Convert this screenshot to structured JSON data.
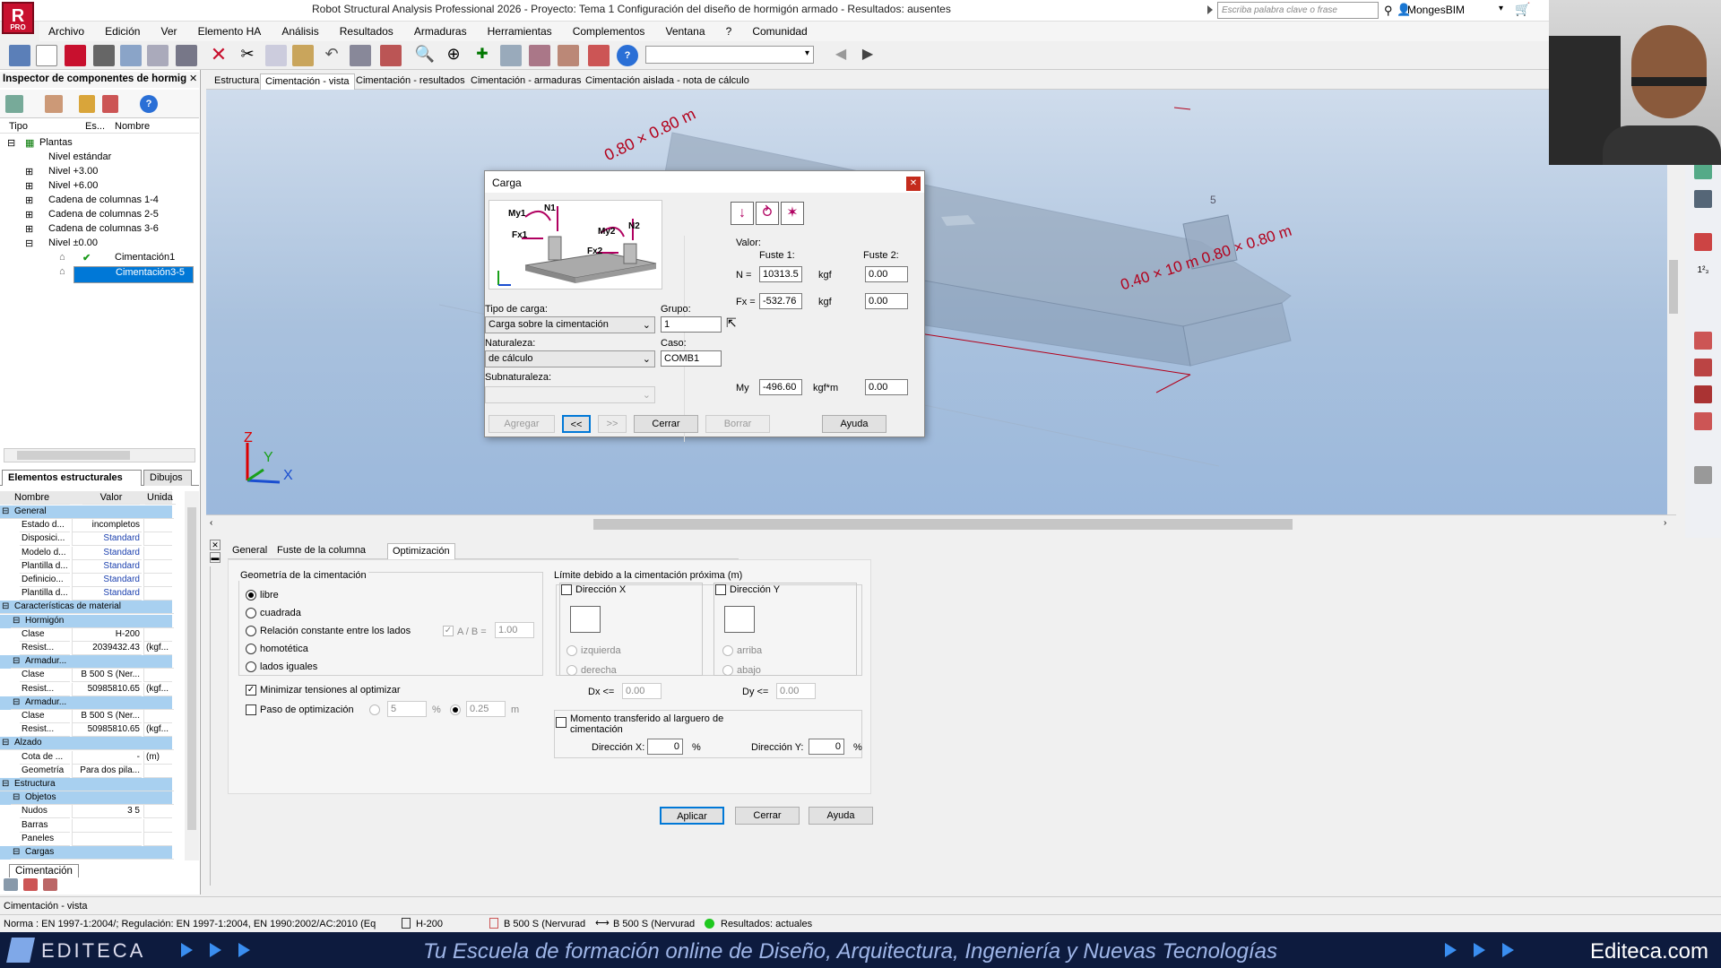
{
  "app": {
    "logo_text": "R",
    "logo_sub": "PRO",
    "title": "Robot Structural Analysis Professional 2026 - Proyecto: Tema 1 Configuración del diseño de hormigón armado - Resultados: ausentes",
    "search_placeholder": "Escriba palabra clave o frase",
    "user": "MongesBIM"
  },
  "menu": [
    "Archivo",
    "Edición",
    "Ver",
    "Elemento HA",
    "Análisis",
    "Resultados",
    "Armaduras",
    "Herramientas",
    "Complementos",
    "Ventana",
    "?",
    "Comunidad"
  ],
  "inspector": {
    "title": "Inspector de componentes de hormig",
    "columns": [
      "Tipo",
      "Es...",
      "Nombre"
    ],
    "tree": [
      {
        "label": "Plantas",
        "level": 0,
        "expander": "⊟"
      },
      {
        "label": "Nivel estándar",
        "level": 1,
        "expander": ""
      },
      {
        "label": "Nivel +3.00",
        "level": 1,
        "expander": "⊞"
      },
      {
        "label": "Nivel +6.00",
        "level": 1,
        "expander": "⊞"
      },
      {
        "label": "Cadena de columnas 1-4",
        "level": 1,
        "expander": "⊞"
      },
      {
        "label": "Cadena de columnas 2-5",
        "level": 1,
        "expander": "⊞"
      },
      {
        "label": "Cadena de columnas 3-6",
        "level": 1,
        "expander": "⊞"
      },
      {
        "label": "Nivel ±0.00",
        "level": 1,
        "expander": "⊟"
      },
      {
        "label": "Cimentación1",
        "level": 2,
        "expander": "",
        "status": "✔"
      },
      {
        "label": "Cimentación3-5",
        "level": 2,
        "expander": "",
        "selected": true
      }
    ],
    "tabs": [
      "Elementos estructurales",
      "Dibujos"
    ],
    "prop_headers": [
      "Nombre",
      "Valor",
      "Unida"
    ],
    "props": [
      {
        "group": "General"
      },
      {
        "name": "Estado d...",
        "value": "incompletos",
        "unit": ""
      },
      {
        "name": "Disposici...",
        "value": "Standard",
        "unit": ""
      },
      {
        "name": "Modelo d...",
        "value": "Standard",
        "unit": ""
      },
      {
        "name": "Plantilla d...",
        "value": "Standard",
        "unit": ""
      },
      {
        "name": "Definicio...",
        "value": "Standard",
        "unit": ""
      },
      {
        "name": "Plantilla d...",
        "value": "Standard",
        "unit": ""
      },
      {
        "group": "Características de material"
      },
      {
        "subgroup": "Hormigón"
      },
      {
        "name": "Clase",
        "value": "H-200",
        "unit": ""
      },
      {
        "name": "Resist...",
        "value": "2039432.43",
        "unit": "(kgf..."
      },
      {
        "subgroup": "Armadur..."
      },
      {
        "name": "Clase",
        "value": "B 500 S (Ner...",
        "unit": ""
      },
      {
        "name": "Resist...",
        "value": "50985810.65",
        "unit": "(kgf..."
      },
      {
        "subgroup": "Armadur..."
      },
      {
        "name": "Clase",
        "value": "B 500 S (Ner...",
        "unit": ""
      },
      {
        "name": "Resist...",
        "value": "50985810.65",
        "unit": "(kgf..."
      },
      {
        "group": "Alzado"
      },
      {
        "name": "Cota de ...",
        "value": "-",
        "unit": "(m)"
      },
      {
        "name": "Geometría",
        "value": "Para dos pila...",
        "unit": ""
      },
      {
        "group": "Estructura"
      },
      {
        "subgroup": "Objetos"
      },
      {
        "name": "Nudos",
        "value": "3 5",
        "unit": ""
      },
      {
        "name": "Barras",
        "value": "",
        "unit": ""
      },
      {
        "name": "Paneles",
        "value": "",
        "unit": ""
      },
      {
        "subgroup": "Cargas"
      }
    ],
    "bottom_tab": "Cimentación"
  },
  "view_tabs": [
    "Estructura",
    "Cimentación - vista",
    "Cimentación - resultados",
    "Cimentación - armaduras",
    "Cimentación aislada - nota de cálculo"
  ],
  "viewport": {
    "dims_back": "0.80 × 0.80 m",
    "dims_front": "0.40 × 10 m  0.80 × 0.80 m",
    "node_label": "5",
    "axis_x": "X",
    "axis_y": "Y",
    "axis_z": "Z"
  },
  "dialog": {
    "title": "Carga",
    "valor_label": "Valor:",
    "fuste1": "Fuste 1:",
    "fuste2": "Fuste 2:",
    "N_label": "N =",
    "N_f1": "10313.5",
    "N_unit": "kgf",
    "N_f2": "0.00",
    "Fx_label": "Fx =",
    "Fx_f1": "-532.76",
    "Fx_unit": "kgf",
    "Fx_f2": "0.00",
    "My_label": "My",
    "My_f1": "-496.60",
    "My_unit": "kgf*m",
    "My_f2": "0.00",
    "tipo_label": "Tipo de carga:",
    "tipo_value": "Carga sobre la cimentación",
    "grupo_label": "Grupo:",
    "grupo_value": "1",
    "naturaleza_label": "Naturaleza:",
    "naturaleza_value": "de cálculo",
    "caso_label": "Caso:",
    "caso_value": "COMB1",
    "subnat_label": "Subnaturaleza:",
    "buttons": {
      "agregar": "Agregar",
      "prev": "<<",
      "next": ">>",
      "cerrar": "Cerrar",
      "borrar": "Borrar",
      "ayuda": "Ayuda"
    },
    "diagram_labels": {
      "My1": "My1",
      "N1": "N1",
      "Fx1": "Fx1",
      "My2": "My2",
      "N2": "N2",
      "Fx2": "Fx2"
    }
  },
  "bottom": {
    "tabs": [
      "General",
      "Fuste de la columna",
      "Optimización"
    ],
    "geom_title": "Geometría de la cimentación",
    "geom_options": [
      "libre",
      "cuadrada",
      "Relación constante entre los lados",
      "homotética",
      "lados iguales"
    ],
    "ab_label": "A / B =",
    "ab_value": "1.00",
    "minimizar": "Minimizar tensiones al optimizar",
    "paso": "Paso de optimización",
    "paso_pct": "5",
    "paso_m": "0.25",
    "pct": "%",
    "m": "m",
    "limite_title": "Límite debido a la cimentación próxima (m)",
    "dir_x": "Dirección X",
    "dir_y": "Dirección Y",
    "izquierda": "izquierda",
    "derecha": "derecha",
    "arriba": "arriba",
    "abajo": "abajo",
    "dx_label": "Dx <=",
    "dx_value": "0.00",
    "dy_label": "Dy <=",
    "dy_value": "0.00",
    "momento": "Momento transferido al larguero de cimentación",
    "dirx_label": "Dirección X:",
    "dirx_value": "0",
    "diry_label": "Dirección Y:",
    "diry_value": "0",
    "aplicar": "Aplicar",
    "cerrar": "Cerrar",
    "ayuda": "Ayuda"
  },
  "status": {
    "view": "Cimentación - vista",
    "norma": "Norma : EN 1997-1:2004/;  Regulación: EN 1997-1:2004, EN 1990:2002/AC:2010  (Eq",
    "concrete": "H-200",
    "steel1": "B 500 S (Nervurad",
    "steel2": "B 500 S (Nervurad",
    "results": "Resultados: actuales"
  },
  "banner": {
    "brand": "EDITECA",
    "slogan": "Tu Escuela de formación online de Diseño, Arquitectura, Ingeniería y Nuevas Tecnologías",
    "site": "Editeca.com"
  },
  "colors": {
    "accent": "#0078d7",
    "brand_red": "#c8102e",
    "banner_bg": "#0d1b3e",
    "dim_red": "#b3001b",
    "group_blue": "#a8d0f0"
  }
}
